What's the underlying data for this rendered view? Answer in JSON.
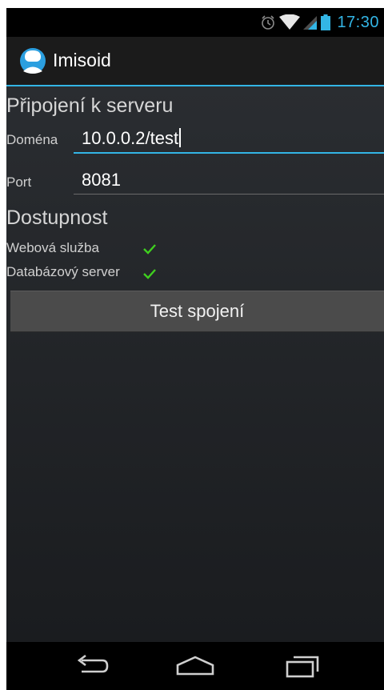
{
  "status_bar": {
    "time": "17:30",
    "icons": [
      "alarm-icon",
      "wifi-icon",
      "signal-icon",
      "battery-icon"
    ]
  },
  "action_bar": {
    "app_icon": "imisoid-logo-icon",
    "title": "Imisoid"
  },
  "server_section": {
    "title": "Připojení k serveru",
    "domain": {
      "label": "Doména",
      "value": "10.0.0.2/test"
    },
    "port": {
      "label": "Port",
      "value": "8081"
    }
  },
  "availability_section": {
    "title": "Dostupnost",
    "items": [
      {
        "label": "Webová služba",
        "status": "check-icon"
      },
      {
        "label": "Databázový server",
        "status": "check-icon"
      }
    ]
  },
  "test_button": {
    "label": "Test spojení"
  },
  "nav_bar": {
    "icons": [
      "back-icon",
      "home-icon",
      "recent-apps-icon"
    ]
  },
  "colors": {
    "accent": "#33b5e5",
    "check": "#3fcf1f",
    "button": "#4b4b4b"
  }
}
